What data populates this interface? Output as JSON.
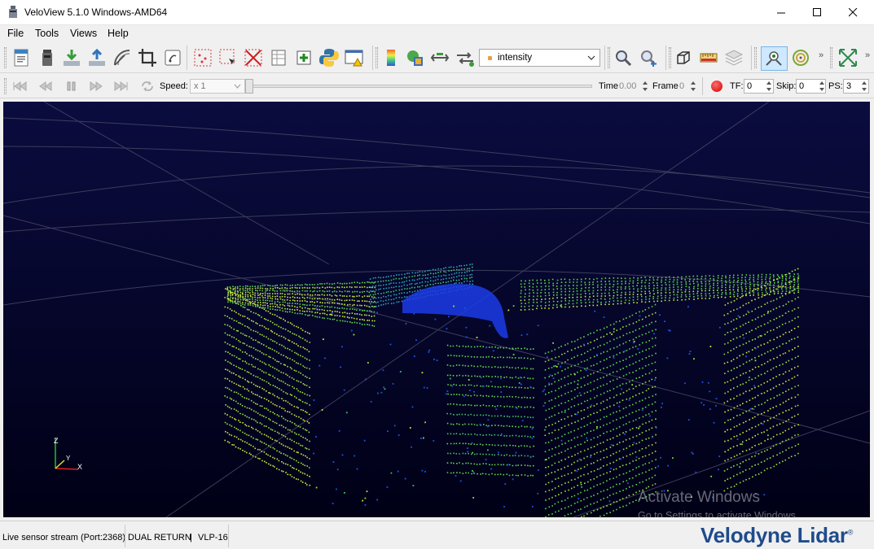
{
  "window": {
    "title": "VeloView 5.1.0 Windows-AMD64",
    "controls": {
      "minimize": "minimize-icon",
      "maximize": "maximize-icon",
      "close": "close-icon"
    }
  },
  "menu": {
    "items": [
      "File",
      "Tools",
      "Views",
      "Help"
    ]
  },
  "toolbar": {
    "color_by": {
      "selected": "intensity"
    },
    "icons": [
      "open-pcap-icon",
      "sensor-stream-icon",
      "save-csv-icon",
      "save-lidar-icon",
      "spreadsheet-arc-icon",
      "crop-icon",
      "touch-source-icon",
      "select-points-icon",
      "select-dual-icon",
      "clear-selection-icon",
      "spreadsheet-icon",
      "add-data-icon",
      "python-icon",
      "error-console-icon",
      "color-legend-icon",
      "color-map-icon",
      "return-switch-icon",
      "dual-return-icon",
      "zoom-icon",
      "zoom-select-icon",
      "reset-camera-icon",
      "measure-icon",
      "layers-icon",
      "center-camera-icon",
      "circle-grid-icon",
      "fit-view-icon"
    ]
  },
  "player": {
    "speed_label": "Speed:",
    "speed_value": "x 1",
    "time_label": "Time",
    "time_value": "0.00",
    "frame_label": "Frame",
    "frame_value": "0",
    "tf_label": "TF:",
    "tf_value": "0",
    "skip_label": "Skip:",
    "skip_value": "0",
    "ps_label": "PS:",
    "ps_value": "3"
  },
  "viewport": {
    "background": "#020230",
    "axes": {
      "z": "Z",
      "y": "Y",
      "x": "X"
    },
    "watermark": {
      "title": "Activate Windows",
      "subtitle": "Go to Settings to activate Windows."
    }
  },
  "status": {
    "stream": "Live sensor stream (Port:2368)",
    "mode": "DUAL RETURN",
    "sep": "|",
    "sensor": "VLP-16"
  },
  "brand": {
    "name": "Velodyne Lidar",
    "mark": "®",
    "color": "#1f4b8c"
  }
}
